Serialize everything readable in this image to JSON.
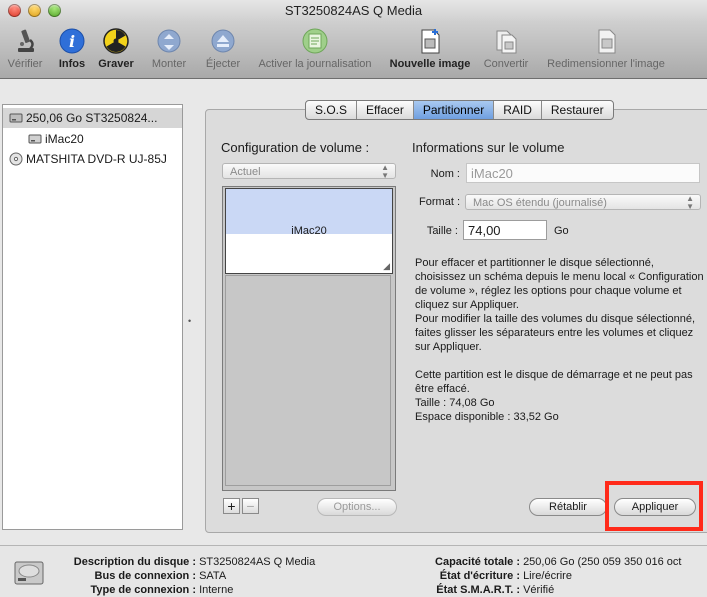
{
  "window": {
    "title": "ST3250824AS Q Media"
  },
  "toolbar": {
    "items": [
      {
        "label": "Vérifier",
        "icon": "microscope-icon",
        "enabled": false
      },
      {
        "label": "Infos",
        "icon": "info-icon",
        "enabled": true,
        "bold": true
      },
      {
        "label": "Graver",
        "icon": "burn-icon",
        "enabled": true,
        "bold": true
      },
      {
        "label": "Monter",
        "icon": "mount-icon",
        "enabled": false
      },
      {
        "label": "Éjecter",
        "icon": "eject-icon",
        "enabled": false
      },
      {
        "label": "Activer la journalisation",
        "icon": "journal-icon",
        "enabled": false
      },
      {
        "label": "Nouvelle image",
        "icon": "new-image-icon",
        "enabled": true,
        "bold": true
      },
      {
        "label": "Convertir",
        "icon": "convert-icon",
        "enabled": false
      },
      {
        "label": "Redimensionner l'image",
        "icon": "resize-image-icon",
        "enabled": false
      }
    ]
  },
  "sidebar": {
    "items": [
      {
        "label": "250,06 Go ST3250824...",
        "icon": "hard-disk-icon",
        "selected": true
      },
      {
        "label": "iMac20",
        "icon": "volume-icon",
        "selected": false
      },
      {
        "label": "MATSHITA DVD-R UJ-85J",
        "icon": "optical-drive-icon",
        "selected": false
      }
    ]
  },
  "tabs": [
    "S.O.S",
    "Effacer",
    "Partitionner",
    "RAID",
    "Restaurer"
  ],
  "active_tab": "Partitionner",
  "partition": {
    "config_label": "Configuration de volume :",
    "scheme_value": "Actuel",
    "volume_name": "iMac20",
    "add_label": "+",
    "remove_label": "−",
    "options_label": "Options..."
  },
  "volume_info": {
    "heading": "Informations sur le volume",
    "name_label": "Nom :",
    "name_value": "iMac20",
    "format_label": "Format :",
    "format_value": "Mac OS étendu (journalisé)",
    "size_label": "Taille :",
    "size_value": "74,00",
    "size_unit": "Go",
    "help_p1": "Pour effacer et partitionner le disque sélectionné, choisissez un schéma depuis le menu local « Configuration de volume », réglez les options pour chaque volume et cliquez sur Appliquer.",
    "help_p2": "Pour modifier la taille des volumes du disque sélectionné, faites glisser les séparateurs entre les volumes et cliquez sur Appliquer.",
    "startup_note": "Cette partition est le disque de démarrage et ne peut pas être effacé.",
    "size_line": "Taille : 74,08 Go",
    "free_line": "Espace disponible : 33,52 Go"
  },
  "buttons": {
    "revert": "Rétablir",
    "apply": "Appliquer"
  },
  "disk_info": {
    "description_label": "Description du disque :",
    "description_value": "ST3250824AS Q Media",
    "bus_label": "Bus de connexion :",
    "bus_value": "SATA",
    "type_label": "Type de connexion :",
    "type_value": "Interne",
    "capacity_label": "Capacité totale :",
    "capacity_value": "250,06 Go (250 059 350 016 oct",
    "write_label": "État d'écriture :",
    "write_value": "Lire/écrire",
    "smart_label": "État S.M.A.R.T. :",
    "smart_value": "Vérifié"
  },
  "colors": {
    "selected_tab": "#6f9fe0",
    "partition_fill": "#cad8f5",
    "highlight": "#ff2a1a"
  }
}
